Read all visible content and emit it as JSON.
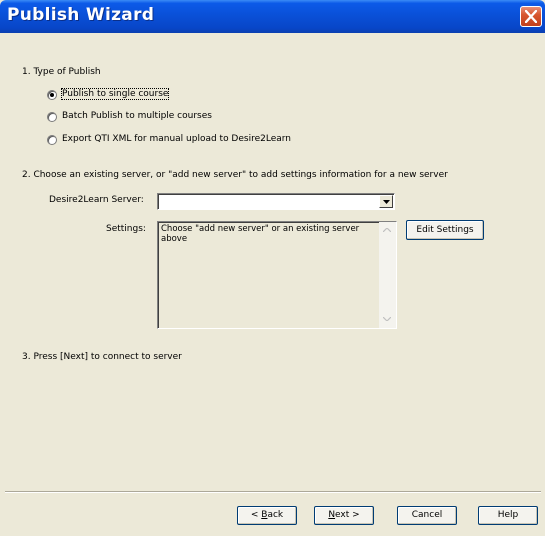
{
  "window": {
    "title": "Publish Wizard"
  },
  "section1": {
    "heading": "1. Type of Publish",
    "options": [
      {
        "label": "Publish to single course",
        "selected": true
      },
      {
        "label": "Batch Publish to multiple courses",
        "selected": false
      },
      {
        "label": "Export QTI XML for manual upload to Desire2Learn",
        "selected": false
      }
    ]
  },
  "section2": {
    "heading": "2. Choose an existing server, or \"add new server\" to add settings information for a new server",
    "server_label": "Desire2Learn Server:",
    "server_value": "",
    "settings_label": "Settings:",
    "settings_text": "Choose \"add new server\" or an existing server above",
    "edit_settings_label": "Edit Settings"
  },
  "section3": {
    "heading": "3. Press [Next] to connect to server"
  },
  "footer": {
    "back_prefix": "< ",
    "back_key": "B",
    "back_rest": "ack",
    "next_key": "N",
    "next_rest": "ext >",
    "cancel_label": "Cancel",
    "help_label": "Help"
  },
  "icons": {
    "close": "close-icon",
    "dropdown": "chevron-down-icon",
    "scroll_up": "scroll-up-arrow-icon",
    "scroll_down": "scroll-down-arrow-icon"
  },
  "colors": {
    "titlebar": "#0a4fd6",
    "close": "#d8572f",
    "window_bg": "#ece9d8",
    "button_border": "#003c74"
  }
}
